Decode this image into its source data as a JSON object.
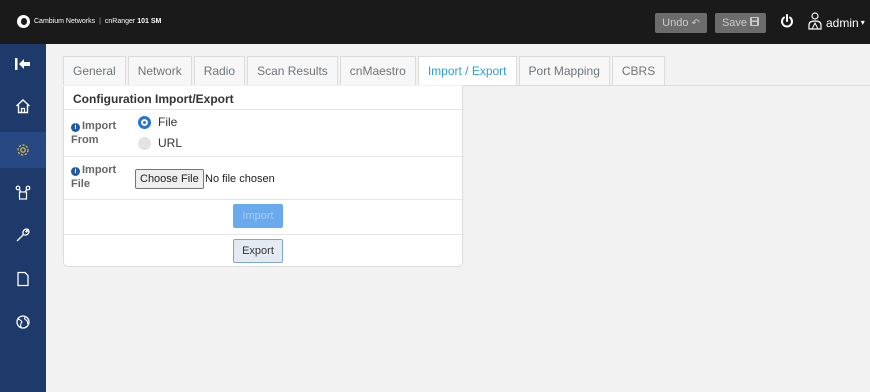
{
  "topbar": {
    "brand_company": "Cambium Networks",
    "brand_separator": "|",
    "brand_product_prefix": "cnRanger",
    "brand_product_model": "101 SM",
    "undo_label": "Undo",
    "save_label": "Save",
    "user_label": "admin"
  },
  "sidebar": {
    "items": [
      {
        "icon": "collapse-pin-icon"
      },
      {
        "icon": "home-icon"
      },
      {
        "icon": "gear-icon",
        "active": true
      },
      {
        "icon": "network-icon"
      },
      {
        "icon": "wrench-icon"
      },
      {
        "icon": "document-icon"
      },
      {
        "icon": "globe-icon"
      }
    ]
  },
  "tabs": [
    {
      "label": "General"
    },
    {
      "label": "Network"
    },
    {
      "label": "Radio"
    },
    {
      "label": "Scan Results"
    },
    {
      "label": "cnMaestro"
    },
    {
      "label": "Import / Export",
      "active": true
    },
    {
      "label": "Port Mapping"
    },
    {
      "label": "CBRS"
    }
  ],
  "panel": {
    "title": "Configuration Import/Export",
    "import_from_label_1": "Import",
    "import_from_label_2": "From",
    "options": [
      {
        "label": "File",
        "selected": true
      },
      {
        "label": "URL",
        "selected": false
      }
    ],
    "import_file_label_1": "Import",
    "import_file_label_2": "File",
    "choose_file_label": "Choose File",
    "no_file_text": "No file chosen",
    "import_button": "Import",
    "export_button": "Export"
  },
  "colors": {
    "topbar": "#1a1a1a",
    "sidebar": "#1e3a6b",
    "accent": "#2b9fd6",
    "info": "#1e5aa8"
  }
}
